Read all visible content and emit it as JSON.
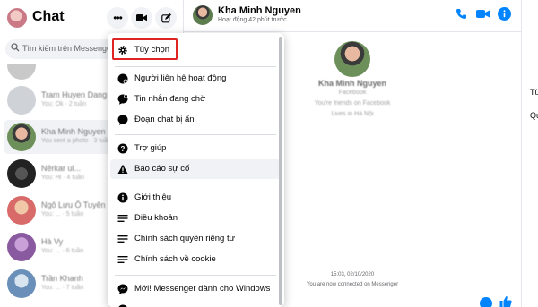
{
  "sidebar": {
    "title": "Chat",
    "search_placeholder": "Tìm kiếm trên Messenger",
    "conversations": [
      {
        "name": "Tram Huyen Dang",
        "preview": "You: Ok · 2 tuần"
      },
      {
        "name": "Kha Minh Nguyen",
        "preview": "You sent a photo · 3 tuần"
      },
      {
        "name": "Nêrkar ul...",
        "preview": "You: Hi · 4 tuần"
      },
      {
        "name": "Ngô Lưu Ô Tuyên",
        "preview": "You: ... · 5 tuần"
      },
      {
        "name": "Hà Vy",
        "preview": "You: ... · 6 tuần"
      },
      {
        "name": "Trần Khanh",
        "preview": "You: ... · 7 tuần"
      }
    ]
  },
  "chat_header": {
    "name": "Kha Minh Nguyen",
    "status": "Hoạt động 42 phút trước"
  },
  "chat_body": {
    "profile_name": "Kha Minh Nguyen",
    "line1": "Facebook",
    "line2": "You're friends on Facebook",
    "line3": "Lives in Hà Nội",
    "timestamp": "15:03, 02/10/2020",
    "connected_text": "You are now connected on Messenger"
  },
  "right_panel": {
    "line1": "Tù",
    "line2": "Qu"
  },
  "menu": {
    "items": [
      {
        "label": "Tùy chọn",
        "icon": "gear-icon"
      },
      {
        "label": "Người liên hệ hoạt động",
        "icon": "active-contacts-icon"
      },
      {
        "label": "Tin nhắn đang chờ",
        "icon": "message-request-icon"
      },
      {
        "label": "Đoạn chat bị ẩn",
        "icon": "hidden-chat-icon"
      },
      {
        "label": "Trợ giúp",
        "icon": "help-icon"
      },
      {
        "label": "Báo cáo sự cố",
        "icon": "warning-icon"
      },
      {
        "label": "Giới thiệu",
        "icon": "info-icon"
      },
      {
        "label": "Điều khoản",
        "icon": "lines-icon"
      },
      {
        "label": "Chính sách quyền riêng tư",
        "icon": "lines-icon"
      },
      {
        "label": "Chính sách về cookie",
        "icon": "lines-icon"
      },
      {
        "label": "Mới! Messenger dành cho Windows",
        "icon": "messenger-icon"
      }
    ]
  },
  "colors": {
    "accent": "#0084ff",
    "highlight": "#e02424",
    "hover": "#f0f2f5"
  }
}
